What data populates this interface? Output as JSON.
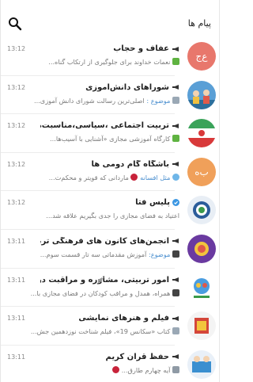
{
  "header": {
    "title": "پیام ها"
  },
  "chats": [
    {
      "name": "عفاف و حجاب",
      "time": "13:12",
      "preview": "نعمات خداوند برای جلوگیری از ارتکاب گناه...",
      "avatar_letters": "ع‌ج",
      "avatar_color": "#e8776c",
      "prefix_icon": "green-check-emoji"
    },
    {
      "name": "شوراهای دانش‌آموزی",
      "time": "13:12",
      "preview_kind": "موضوع :",
      "preview": "اصلی‌ترین رسالت شورای دانش آموزی...",
      "prefix_icon": "photo-icon"
    },
    {
      "name": "تربیت اجتماعی ،سیاسی،مناسبت‌ها",
      "time": "13:12",
      "preview": "کارگاه آموزشی مجازی «آشنایی با آسیب‌ها...",
      "prefix_icon": "green-check-emoji"
    },
    {
      "name": "باشگاه گام دومی ها",
      "time": "13:12",
      "preview": "ماردانی که قویتر و محکم‌ت...",
      "preview_kind": "مثل افسانه",
      "avatar_letters": "ب‌ه",
      "avatar_color": "#f0a05a",
      "prefix_icon": "butterfly-emoji",
      "suffix_icon": "rose-emoji"
    },
    {
      "name": "پلیس فتا",
      "time": "13:12",
      "preview": "اعتیاد به فضای مجازی را جدی بگیریم علاقه شد...",
      "verified": true
    },
    {
      "name": "انجمن‌های کانون های فرهنگی تربیتی",
      "time": "13:11",
      "preview_kind": "موضوع:",
      "preview": "آموزش مقدماتی سه تار قسمت سوم...",
      "prefix_icon": "clapper-emoji"
    },
    {
      "name": "امور تربیتی، مشاوره و مراقبت در برا...",
      "time": "13:11",
      "preview": "همراه، همدل و مراقب کودکان در فضای مجازی با...",
      "muted": true,
      "prefix_icon": "clapper-emoji"
    },
    {
      "name": "فیلم و هنرهای نمایشی",
      "time": "13:11",
      "preview": "کتاب «سکانس 19»، فیلم شناخت نوزدهمین جش...",
      "prefix_icon": "photo-icon"
    },
    {
      "name": "حفظ قرآن کریم",
      "time": "13:11",
      "preview": "آیه چهارم طارق...",
      "prefix_icon": "hash-emoji",
      "suffix_icon": "rose-emoji"
    }
  ]
}
